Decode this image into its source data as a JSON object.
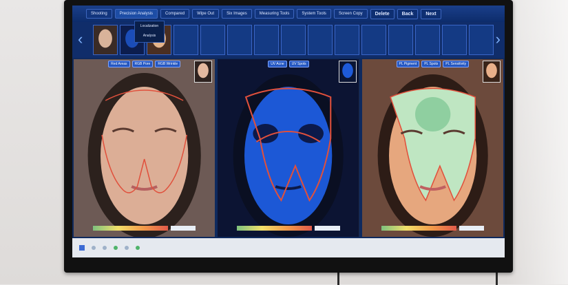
{
  "menu": {
    "items": [
      "Shooting",
      "Precision Analysis",
      "Compared",
      "Wipe Out",
      "Six Images",
      "Measuring Tools",
      "System Tools",
      "Screen Copy"
    ],
    "delete": "Delete",
    "back": "Back",
    "next": "Next"
  },
  "submenu": {
    "item1": "Localization",
    "item2": "Analysis"
  },
  "panels": [
    {
      "chips": [
        "Red Areas",
        "RGB Pore",
        "RGB Wrinkle"
      ]
    },
    {
      "chips": [
        "UV Acne",
        "UV Spots"
      ]
    },
    {
      "chips": [
        "PL Pigment",
        "PL Spots",
        "PL Sensitivity"
      ]
    }
  ],
  "colors": {
    "screen": "#0f2a5e",
    "outline_red": "#e0503c",
    "uv_blue": "#1c58d6",
    "skin": "#d9a98c",
    "sensitivity_green": "#bfe6c2"
  }
}
